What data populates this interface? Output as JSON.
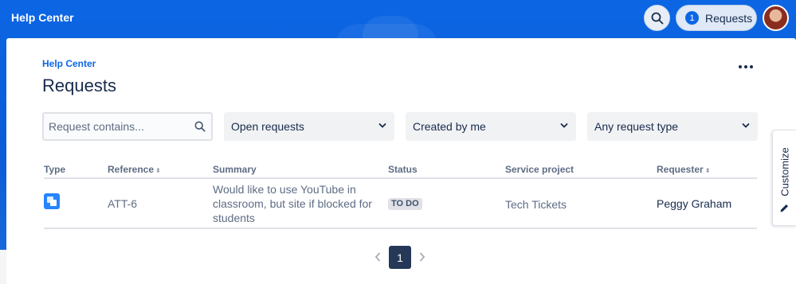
{
  "header": {
    "brand": "Help Center",
    "requests_count": "1",
    "requests_label": "Requests",
    "icons": {
      "search": "search-icon",
      "avatar": "avatar"
    }
  },
  "page": {
    "breadcrumb": "Help Center",
    "title": "Requests",
    "more_icon": "more-icon"
  },
  "filters": {
    "search_placeholder": "Request contains...",
    "search_value": "",
    "status_select": "Open requests",
    "creator_select": "Created by me",
    "type_select": "Any request type"
  },
  "table": {
    "headers": {
      "type": "Type",
      "reference": "Reference",
      "summary": "Summary",
      "status": "Status",
      "service_project": "Service project",
      "requester": "Requester"
    },
    "rows": [
      {
        "type_icon": "request-type-icon",
        "reference": "ATT-6",
        "summary": "Would like to use YouTube in classroom, but site if blocked for students",
        "status": "TO DO",
        "service_project": "Tech Tickets",
        "requester": "Peggy Graham"
      }
    ]
  },
  "pagination": {
    "current_page": "1"
  },
  "customize": {
    "label": "Customize"
  },
  "colors": {
    "header_blue": "#0c66e4",
    "type_icon_blue": "#2684ff",
    "page_button": "#253858",
    "link": "#0c66e4"
  }
}
